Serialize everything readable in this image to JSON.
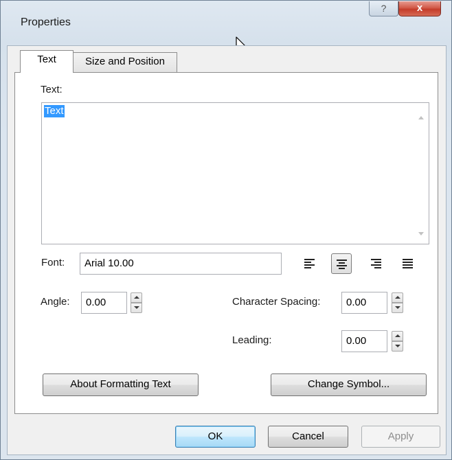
{
  "window": {
    "title": "Properties",
    "help_label": "?",
    "close_label": "x"
  },
  "tabs": [
    {
      "label": "Text",
      "selected": true
    },
    {
      "label": "Size and Position",
      "selected": false
    }
  ],
  "text_section": {
    "label": "Text:",
    "value": "Text"
  },
  "font": {
    "label": "Font:",
    "value": "Arial 10.00"
  },
  "alignment": {
    "options": [
      "align-left",
      "align-center",
      "align-right",
      "align-justify"
    ],
    "selected": "align-center"
  },
  "angle": {
    "label": "Angle:",
    "value": "0.00"
  },
  "character_spacing": {
    "label": "Character Spacing:",
    "value": "0.00"
  },
  "leading": {
    "label": "Leading:",
    "value": "0.00"
  },
  "buttons": {
    "about_formatting": "About Formatting Text",
    "change_symbol": "Change Symbol...",
    "ok": "OK",
    "cancel": "Cancel",
    "apply": "Apply"
  }
}
